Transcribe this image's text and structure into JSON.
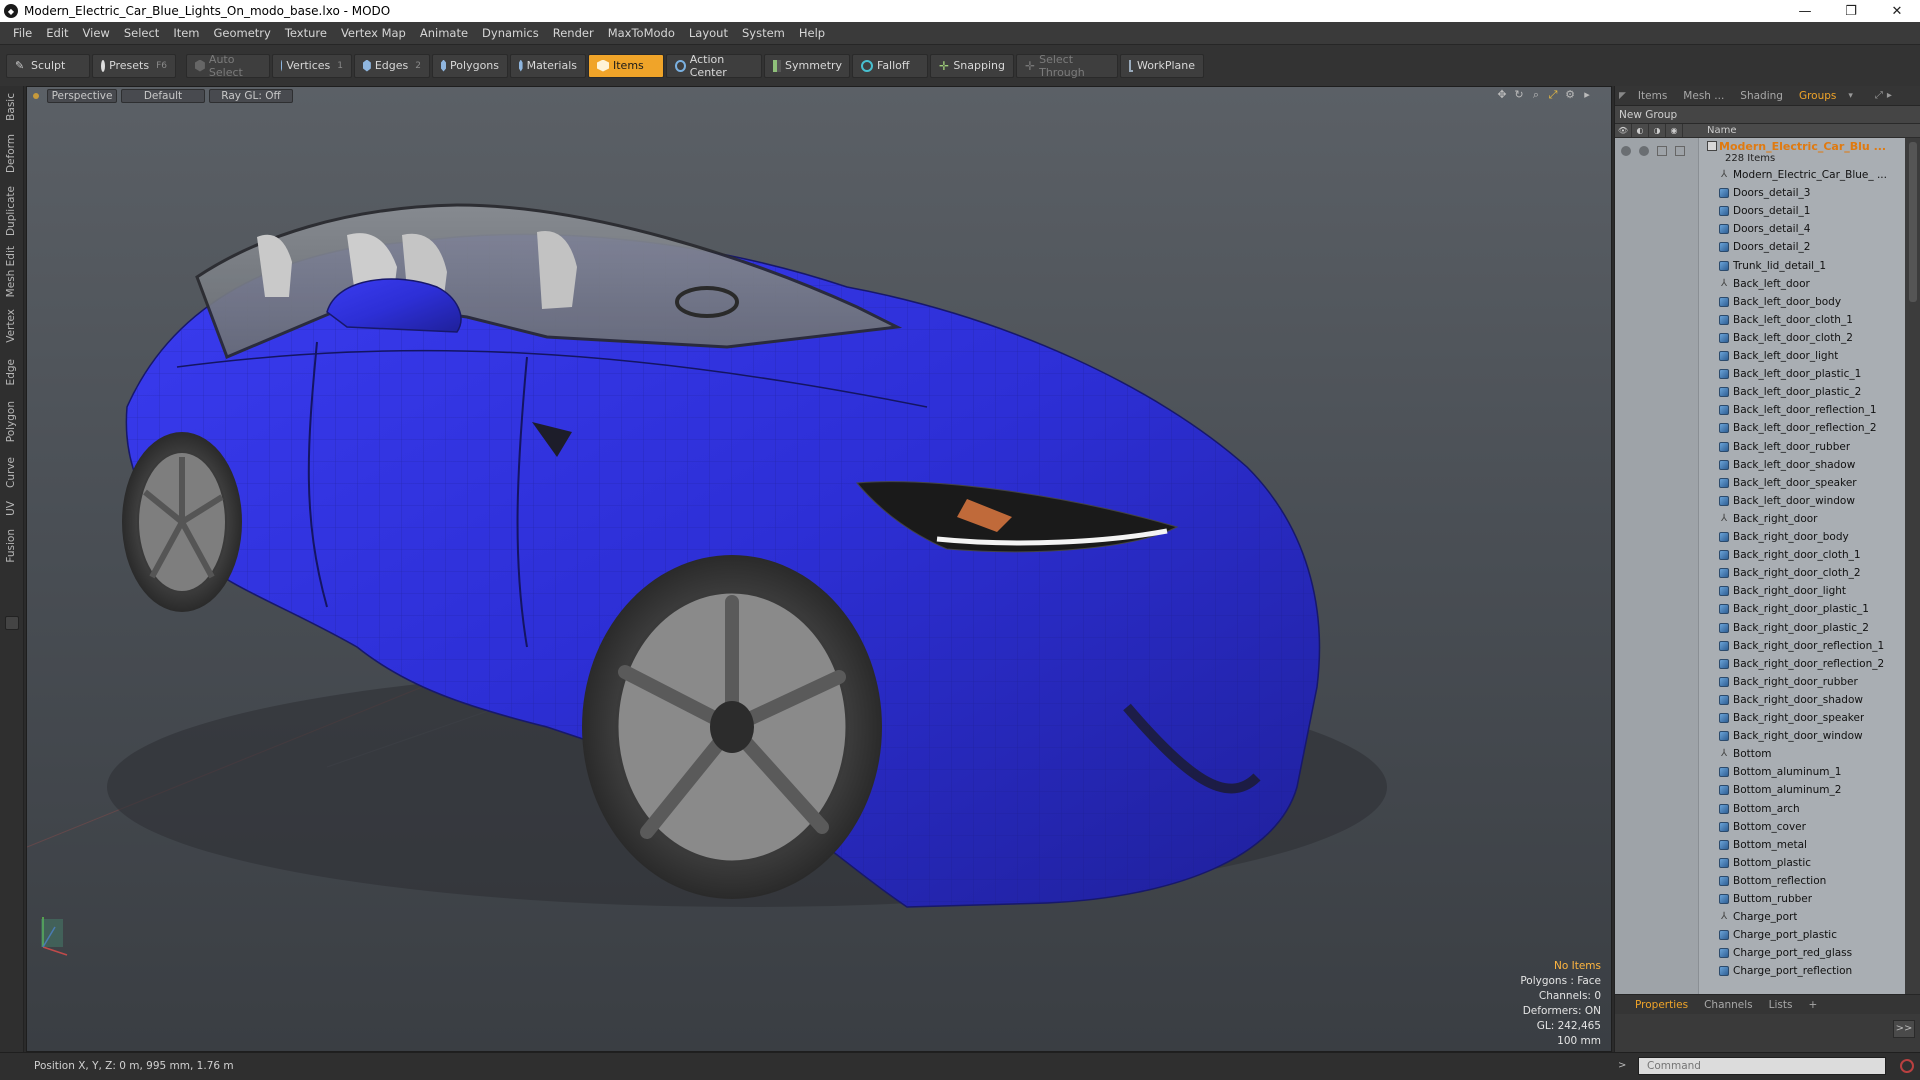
{
  "titlebar": {
    "title": "Modern_Electric_Car_Blue_Lights_On_modo_base.lxo - MODO",
    "minimize": "—",
    "maximize": "❐",
    "close": "✕"
  },
  "menu": [
    "File",
    "Edit",
    "View",
    "Select",
    "Item",
    "Geometry",
    "Texture",
    "Vertex Map",
    "Animate",
    "Dynamics",
    "Render",
    "MaxToModo",
    "Layout",
    "System",
    "Help"
  ],
  "toolbar": {
    "sculpt": "Sculpt",
    "presets": "Presets",
    "presets_key": "F6",
    "auto_select": "Auto Select",
    "vertices": "Vertices",
    "vertices_key": "1",
    "edges": "Edges",
    "edges_key": "2",
    "polygons": "Polygons",
    "materials": "Materials",
    "items": "Items",
    "action_center": "Action Center",
    "symmetry": "Symmetry",
    "falloff": "Falloff",
    "snapping": "Snapping",
    "select_through": "Select Through",
    "workplane": "WorkPlane"
  },
  "left_tabs": [
    "Basic",
    "Deform",
    "Duplicate",
    "Mesh Edit",
    "Vertex",
    "Edge",
    "Polygon",
    "Curve",
    "UV",
    "Fusion"
  ],
  "viewport": {
    "view": "Perspective",
    "shading": "Default",
    "raygl": "Ray GL: Off",
    "stats": {
      "no_items": "No Items",
      "polygons": "Polygons : Face",
      "channels": "Channels: 0",
      "deformers": "Deformers: ON",
      "gl": "GL: 242,465",
      "unit": "100 mm"
    }
  },
  "right_panel": {
    "tabs": [
      "Items",
      "Mesh ...",
      "Shading",
      "Groups"
    ],
    "active_tab": "Groups",
    "new_group": "New Group",
    "column_name": "Name",
    "group_name": "Modern_Electric_Car_Blu ...",
    "group_count": "228 Items",
    "items": [
      {
        "label": "Modern_Electric_Car_Blue_ ...",
        "icon": "locator"
      },
      {
        "label": "Doors_detail_3",
        "icon": "mesh"
      },
      {
        "label": "Doors_detail_1",
        "icon": "mesh"
      },
      {
        "label": "Doors_detail_4",
        "icon": "mesh"
      },
      {
        "label": "Doors_detail_2",
        "icon": "mesh"
      },
      {
        "label": "Trunk_lid_detail_1",
        "icon": "mesh"
      },
      {
        "label": "Back_left_door",
        "icon": "locator"
      },
      {
        "label": "Back_left_door_body",
        "icon": "mesh"
      },
      {
        "label": "Back_left_door_cloth_1",
        "icon": "mesh"
      },
      {
        "label": "Back_left_door_cloth_2",
        "icon": "mesh"
      },
      {
        "label": "Back_left_door_light",
        "icon": "mesh"
      },
      {
        "label": "Back_left_door_plastic_1",
        "icon": "mesh"
      },
      {
        "label": "Back_left_door_plastic_2",
        "icon": "mesh"
      },
      {
        "label": "Back_left_door_reflection_1",
        "icon": "mesh"
      },
      {
        "label": "Back_left_door_reflection_2",
        "icon": "mesh"
      },
      {
        "label": "Back_left_door_rubber",
        "icon": "mesh"
      },
      {
        "label": "Back_left_door_shadow",
        "icon": "mesh"
      },
      {
        "label": "Back_left_door_speaker",
        "icon": "mesh"
      },
      {
        "label": "Back_left_door_window",
        "icon": "mesh"
      },
      {
        "label": "Back_right_door",
        "icon": "locator"
      },
      {
        "label": "Back_right_door_body",
        "icon": "mesh"
      },
      {
        "label": "Back_right_door_cloth_1",
        "icon": "mesh"
      },
      {
        "label": "Back_right_door_cloth_2",
        "icon": "mesh"
      },
      {
        "label": "Back_right_door_light",
        "icon": "mesh"
      },
      {
        "label": "Back_right_door_plastic_1",
        "icon": "mesh"
      },
      {
        "label": "Back_right_door_plastic_2",
        "icon": "mesh"
      },
      {
        "label": "Back_right_door_reflection_1",
        "icon": "mesh"
      },
      {
        "label": "Back_right_door_reflection_2",
        "icon": "mesh"
      },
      {
        "label": "Back_right_door_rubber",
        "icon": "mesh"
      },
      {
        "label": "Back_right_door_shadow",
        "icon": "mesh"
      },
      {
        "label": "Back_right_door_speaker",
        "icon": "mesh"
      },
      {
        "label": "Back_right_door_window",
        "icon": "mesh"
      },
      {
        "label": "Bottom",
        "icon": "locator"
      },
      {
        "label": "Bottom_aluminum_1",
        "icon": "mesh"
      },
      {
        "label": "Bottom_aluminum_2",
        "icon": "mesh"
      },
      {
        "label": "Bottom_arch",
        "icon": "mesh"
      },
      {
        "label": "Bottom_cover",
        "icon": "mesh"
      },
      {
        "label": "Bottom_metal",
        "icon": "mesh"
      },
      {
        "label": "Bottom_plastic",
        "icon": "mesh"
      },
      {
        "label": "Bottom_reflection",
        "icon": "mesh"
      },
      {
        "label": "Buttom_rubber",
        "icon": "mesh"
      },
      {
        "label": "Charge_port",
        "icon": "locator"
      },
      {
        "label": "Charge_port_plastic",
        "icon": "mesh"
      },
      {
        "label": "Charge_port_red_glass",
        "icon": "mesh"
      },
      {
        "label": "Charge_port_reflection",
        "icon": "mesh"
      }
    ],
    "bottom_tabs": [
      "Properties",
      "Channels",
      "Lists",
      "+"
    ],
    "active_bottom_tab": "Properties",
    "go_button": ">>"
  },
  "status": {
    "position": "Position X, Y, Z:  0 m, 995 mm, 1.76 m"
  },
  "command": {
    "prompt": ">",
    "placeholder": "Command"
  },
  "colors": {
    "accent": "#f0a429",
    "car_paint": "#2d2fd6",
    "group_name": "#e07a10"
  }
}
